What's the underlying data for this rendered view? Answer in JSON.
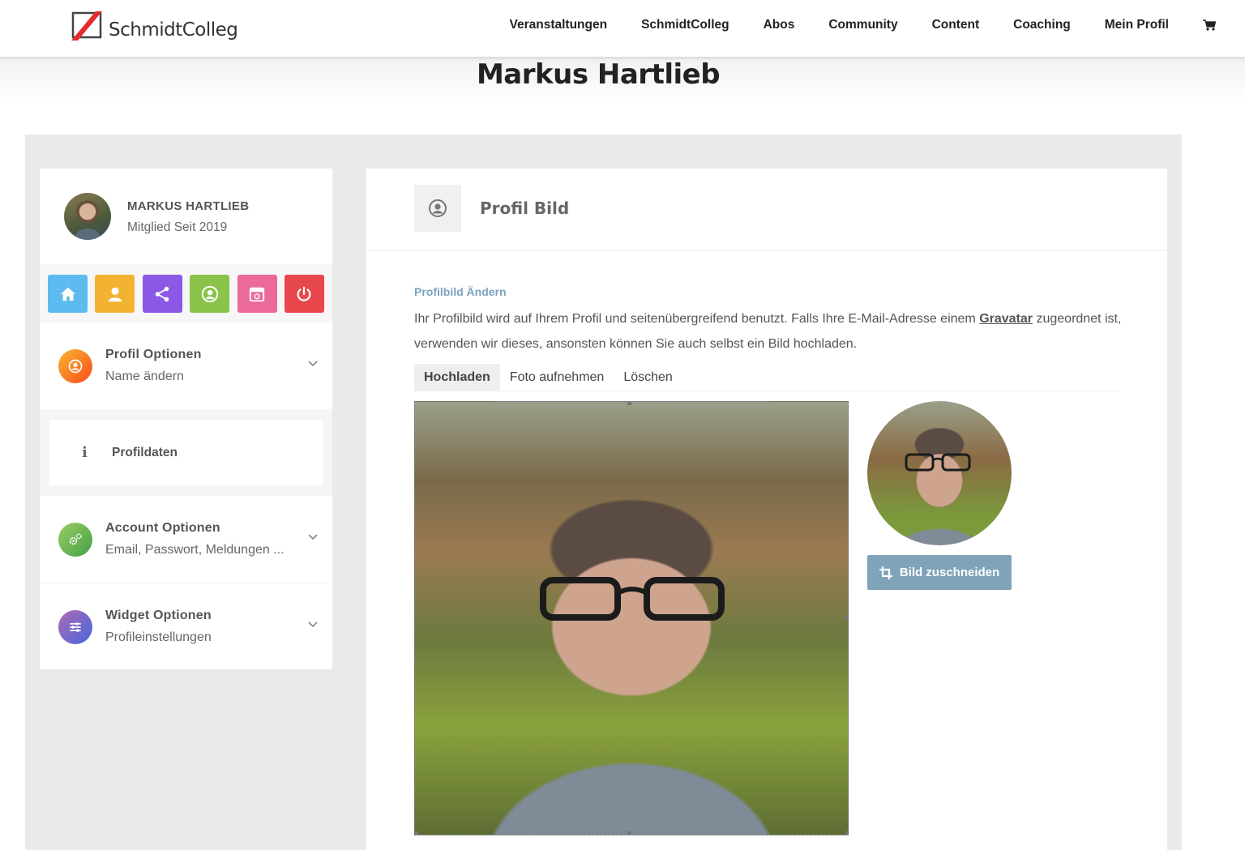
{
  "header": {
    "logo_text": "SchmidtColleg",
    "nav": [
      "Veranstaltungen",
      "SchmidtColleg",
      "Abos",
      "Community",
      "Content",
      "Coaching",
      "Mein Profil"
    ]
  },
  "page": {
    "title": "Markus Hartlieb"
  },
  "sidebar": {
    "name": "MARKUS HARTLIEB",
    "since": "Mitglied Seit 2019",
    "icon_buttons": [
      {
        "icon": "home-icon",
        "color": "#5dbbf0"
      },
      {
        "icon": "user-icon",
        "color": "#f3b332"
      },
      {
        "icon": "share-icon",
        "color": "#8c59e6"
      },
      {
        "icon": "user-circle-icon",
        "color": "#8bc34a"
      },
      {
        "icon": "calendar-icon",
        "color": "#eb6a9a"
      },
      {
        "icon": "power-icon",
        "color": "#e8474b"
      }
    ],
    "menu": {
      "profile": {
        "title": "Profil Optionen",
        "sub": "Name ändern"
      },
      "profildaten": "Profildaten",
      "account": {
        "title": "Account Optionen",
        "sub": "Email, Passwort, Meldungen ..."
      },
      "widget": {
        "title": "Widget Optionen",
        "sub": "Profileinstellungen"
      }
    }
  },
  "main": {
    "title": "Profil Bild",
    "section_label": "Profilbild Ändern",
    "desc_before": "Ihr Profilbild wird auf Ihrem Profil und seitenübergreifend benutzt. Falls Ihre E-Mail-Adresse einem ",
    "desc_link": "Gravatar",
    "desc_after": " zugeordnet ist, verwenden wir dieses, ansonsten können Sie auch selbst ein Bild hochladen.",
    "tabs": [
      "Hochladen",
      "Foto aufnehmen",
      "Löschen"
    ],
    "crop_button": "Bild zuschneiden"
  },
  "colors": {
    "accent": "#7fa4ba",
    "label": "#7ba3bd"
  }
}
